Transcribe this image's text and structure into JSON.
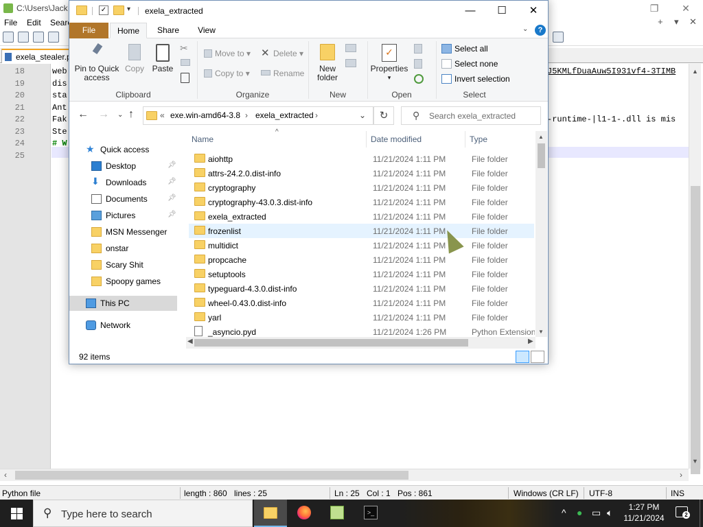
{
  "npp": {
    "title": "C:\\Users\\Jack P",
    "menu": [
      "File",
      "Edit",
      "Search"
    ],
    "tab_label": "exela_stealer.p",
    "lines": [
      {
        "num": "18",
        "text": "web",
        "right": "J5KMLfDuaAuw5I931vf4-3TIMB"
      },
      {
        "num": "19",
        "text": "dis",
        "right": ""
      },
      {
        "num": "20",
        "text": "sta",
        "right": ""
      },
      {
        "num": "21",
        "text": "Ant",
        "right": ""
      },
      {
        "num": "22",
        "text": "Fak",
        "right": "-runtime-|l1-1-.dll is mis"
      },
      {
        "num": "23",
        "text": "Ste",
        "right": ""
      },
      {
        "num": "24",
        "text": "# W",
        "right": ""
      },
      {
        "num": "25",
        "text": "",
        "right": ""
      }
    ],
    "status": {
      "filetype": "Python file",
      "length": "length : 860",
      "lines": "lines : 25",
      "ln": "Ln : 25",
      "col": "Col : 1",
      "pos": "Pos : 861",
      "eol": "Windows (CR LF)",
      "encoding": "UTF-8",
      "mode": "INS"
    }
  },
  "explorer": {
    "title": "exela_extracted",
    "tabs": {
      "file": "File",
      "home": "Home",
      "share": "Share",
      "view": "View"
    },
    "ribbon": {
      "pin": "Pin to Quick access",
      "copy": "Copy",
      "paste": "Paste",
      "clipboard_group": "Clipboard",
      "move_to": "Move to",
      "copy_to": "Copy to",
      "delete": "Delete",
      "rename": "Rename",
      "organize_group": "Organize",
      "new_folder": "New folder",
      "new_group": "New",
      "properties": "Properties",
      "open_group": "Open",
      "select_all": "Select all",
      "select_none": "Select none",
      "invert_selection": "Invert selection",
      "select_group": "Select"
    },
    "address": {
      "prefix": "«",
      "crumbs": [
        "exe.win-amd64-3.8",
        "exela_extracted"
      ],
      "search_placeholder": "Search exela_extracted"
    },
    "nav": [
      {
        "label": "Quick access",
        "icon": "star",
        "pinned": false,
        "indent": 0
      },
      {
        "label": "Desktop",
        "icon": "desktop",
        "pinned": true,
        "indent": 1
      },
      {
        "label": "Downloads",
        "icon": "download",
        "pinned": true,
        "indent": 1
      },
      {
        "label": "Documents",
        "icon": "document",
        "pinned": true,
        "indent": 1
      },
      {
        "label": "Pictures",
        "icon": "pictures",
        "pinned": true,
        "indent": 1
      },
      {
        "label": "MSN Messenger",
        "icon": "folder",
        "pinned": false,
        "indent": 1
      },
      {
        "label": "onstar",
        "icon": "folder",
        "pinned": false,
        "indent": 1
      },
      {
        "label": "Scary Shit",
        "icon": "folder",
        "pinned": false,
        "indent": 1
      },
      {
        "label": "Spoopy games",
        "icon": "folder",
        "pinned": false,
        "indent": 1
      },
      {
        "label": "This PC",
        "icon": "pc",
        "pinned": false,
        "indent": 0
      },
      {
        "label": "Network",
        "icon": "network",
        "pinned": false,
        "indent": 0
      }
    ],
    "columns": {
      "name": "Name",
      "date": "Date modified",
      "type": "Type"
    },
    "files": [
      {
        "name": "aiohttp",
        "date": "11/21/2024 1:11 PM",
        "type": "File folder",
        "kind": "folder"
      },
      {
        "name": "attrs-24.2.0.dist-info",
        "date": "11/21/2024 1:11 PM",
        "type": "File folder",
        "kind": "folder"
      },
      {
        "name": "cryptography",
        "date": "11/21/2024 1:11 PM",
        "type": "File folder",
        "kind": "folder"
      },
      {
        "name": "cryptography-43.0.3.dist-info",
        "date": "11/21/2024 1:11 PM",
        "type": "File folder",
        "kind": "folder"
      },
      {
        "name": "exela_extracted",
        "date": "11/21/2024 1:11 PM",
        "type": "File folder",
        "kind": "folder"
      },
      {
        "name": "frozenlist",
        "date": "11/21/2024 1:11 PM",
        "type": "File folder",
        "kind": "folder"
      },
      {
        "name": "multidict",
        "date": "11/21/2024 1:11 PM",
        "type": "File folder",
        "kind": "folder"
      },
      {
        "name": "propcache",
        "date": "11/21/2024 1:11 PM",
        "type": "File folder",
        "kind": "folder"
      },
      {
        "name": "setuptools",
        "date": "11/21/2024 1:11 PM",
        "type": "File folder",
        "kind": "folder"
      },
      {
        "name": "typeguard-4.3.0.dist-info",
        "date": "11/21/2024 1:11 PM",
        "type": "File folder",
        "kind": "folder"
      },
      {
        "name": "wheel-0.43.0.dist-info",
        "date": "11/21/2024 1:11 PM",
        "type": "File folder",
        "kind": "folder"
      },
      {
        "name": "yarl",
        "date": "11/21/2024 1:11 PM",
        "type": "File folder",
        "kind": "folder"
      },
      {
        "name": "_asyncio.pyd",
        "date": "11/21/2024 1:26 PM",
        "type": "Python Extension ...",
        "kind": "file"
      }
    ],
    "item_count": "92 items"
  },
  "taskbar": {
    "search_placeholder": "Type here to search",
    "time": "1:27 PM",
    "date": "11/21/2024",
    "notification_count": "2"
  },
  "colors": {
    "file_tab": "#b1762a",
    "folder": "#f8d165",
    "taskbar": "#1f1f1f",
    "accent": "#1979ca"
  }
}
